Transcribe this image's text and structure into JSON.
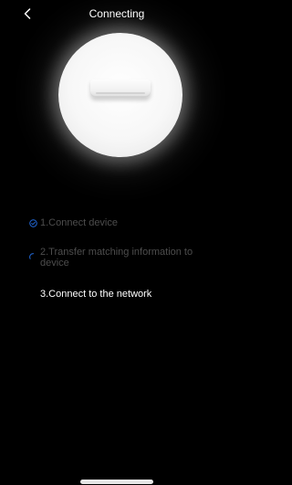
{
  "header": {
    "title": "Connecting"
  },
  "steps": [
    {
      "label": "1.Connect device",
      "status": "done"
    },
    {
      "label": "2.Transfer matching information to device",
      "status": "in-progress"
    },
    {
      "label": "3.Connect to the network",
      "status": "pending"
    }
  ],
  "colors": {
    "background": "#000000",
    "accent": "#1f5fc4",
    "muted_text": "#4d4d4d",
    "primary_text": "#ffffff"
  },
  "icons": {
    "back": "chevron-left-icon",
    "device": "air-conditioner-icon",
    "step_done": "check-circle-icon",
    "step_in_progress": "spinner-icon"
  }
}
